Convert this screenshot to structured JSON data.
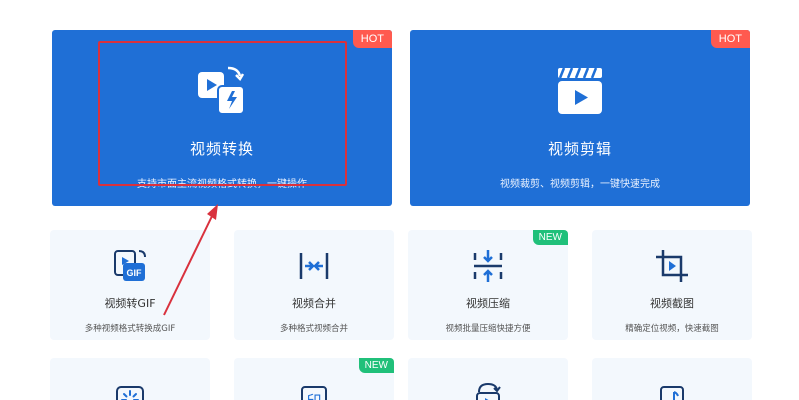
{
  "features": [
    {
      "title": "视频转换",
      "desc": "支持市面主流视频格式转换，一键操作",
      "badge": "HOT",
      "icon": "video-convert-icon"
    },
    {
      "title": "视频剪辑",
      "desc": "视频裁剪、视频剪辑，一键快速完成",
      "badge": "HOT",
      "icon": "clapperboard-icon"
    }
  ],
  "tools": [
    {
      "title": "视频转GIF",
      "desc": "多种视频格式转换成GIF",
      "icon": "gif-icon"
    },
    {
      "title": "视频合并",
      "desc": "多种格式视频合并",
      "icon": "merge-icon"
    },
    {
      "title": "视频压缩",
      "desc": "视频批量压缩快捷方便",
      "badge": "NEW",
      "icon": "compress-icon"
    },
    {
      "title": "视频截图",
      "desc": "精确定位视频，快速截图",
      "icon": "crop-play-icon"
    }
  ],
  "tools_row3": [
    {
      "icon": "loading-icon"
    },
    {
      "icon": "stamp-icon",
      "glyph": "印",
      "badge": "NEW"
    },
    {
      "icon": "rotate-play-icon"
    },
    {
      "icon": "music-file-icon"
    }
  ],
  "colors": {
    "primary": "#1f6fd6",
    "hot": "#ff5a4f",
    "new": "#20c07a",
    "highlight": "#d9313d",
    "tile_bg": "#f3f8fd"
  }
}
